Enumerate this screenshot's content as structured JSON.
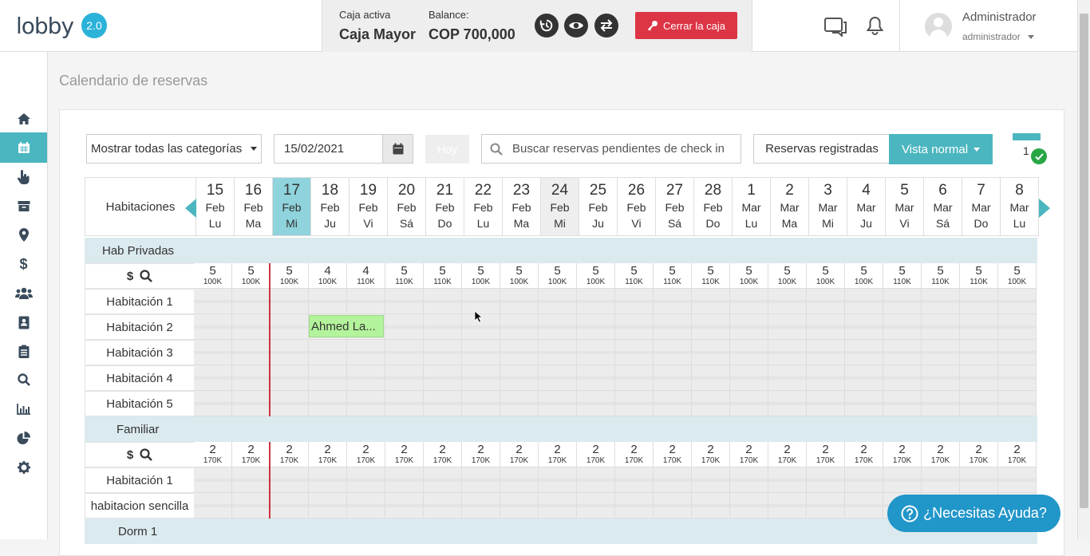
{
  "app": {
    "logo": "lobby",
    "version": "2.0"
  },
  "cash": {
    "active_label": "Caja activa",
    "active_value": "Caja Mayor",
    "balance_label": "Balance:",
    "balance_value": "COP 700,000",
    "close_label": "Cerrar la caja"
  },
  "user": {
    "name": "Administrador",
    "role": "administrador"
  },
  "sidebar": [
    {
      "icon": "home-icon"
    },
    {
      "icon": "calendar-icon",
      "active": true
    },
    {
      "icon": "hand-pointer-icon"
    },
    {
      "icon": "archive-icon"
    },
    {
      "icon": "map-marker-icon"
    },
    {
      "icon": "dollar-icon"
    },
    {
      "icon": "users-icon"
    },
    {
      "icon": "address-book-icon"
    },
    {
      "icon": "clipboard-icon"
    },
    {
      "icon": "search-icon"
    },
    {
      "icon": "bar-chart-icon"
    },
    {
      "icon": "pie-chart-icon"
    },
    {
      "icon": "gear-icon"
    }
  ],
  "page": {
    "title": "Calendario de reservas"
  },
  "toolbar": {
    "category_select": "Mostrar todas las categorías",
    "date_value": "15/02/2021",
    "today_label": "Hoy",
    "search_placeholder": "Buscar reservas pendientes de check in",
    "registered_label": "Reservas registradas",
    "view_label": "Vista normal",
    "notification_count": "1"
  },
  "calendar": {
    "rooms_header": "Habitaciones",
    "days": [
      {
        "d": "15",
        "m": "Feb",
        "w": "Lu"
      },
      {
        "d": "16",
        "m": "Feb",
        "w": "Ma"
      },
      {
        "d": "17",
        "m": "Feb",
        "w": "Mi",
        "today": true
      },
      {
        "d": "18",
        "m": "Feb",
        "w": "Ju"
      },
      {
        "d": "19",
        "m": "Feb",
        "w": "Vi"
      },
      {
        "d": "20",
        "m": "Feb",
        "w": "Sá"
      },
      {
        "d": "21",
        "m": "Feb",
        "w": "Do"
      },
      {
        "d": "22",
        "m": "Feb",
        "w": "Lu"
      },
      {
        "d": "23",
        "m": "Feb",
        "w": "Ma"
      },
      {
        "d": "24",
        "m": "Feb",
        "w": "Mi",
        "highlight": true
      },
      {
        "d": "25",
        "m": "Feb",
        "w": "Ju"
      },
      {
        "d": "26",
        "m": "Feb",
        "w": "Vi"
      },
      {
        "d": "27",
        "m": "Feb",
        "w": "Sá"
      },
      {
        "d": "28",
        "m": "Feb",
        "w": "Do"
      },
      {
        "d": "1",
        "m": "Mar",
        "w": "Lu"
      },
      {
        "d": "2",
        "m": "Mar",
        "w": "Ma"
      },
      {
        "d": "3",
        "m": "Mar",
        "w": "Mi"
      },
      {
        "d": "4",
        "m": "Mar",
        "w": "Ju"
      },
      {
        "d": "5",
        "m": "Mar",
        "w": "Vi"
      },
      {
        "d": "6",
        "m": "Mar",
        "w": "Sá"
      },
      {
        "d": "7",
        "m": "Mar",
        "w": "Do"
      },
      {
        "d": "8",
        "m": "Mar",
        "w": "Lu"
      }
    ],
    "categories": [
      {
        "name": "Hab Privadas",
        "availability": [
          [
            "5",
            "100K"
          ],
          [
            "5",
            "100K"
          ],
          [
            "5",
            "100K"
          ],
          [
            "4",
            "100K"
          ],
          [
            "4",
            "110K"
          ],
          [
            "5",
            "110K"
          ],
          [
            "5",
            "110K"
          ],
          [
            "5",
            "100K"
          ],
          [
            "5",
            "100K"
          ],
          [
            "5",
            "100K"
          ],
          [
            "5",
            "100K"
          ],
          [
            "5",
            "110K"
          ],
          [
            "5",
            "110K"
          ],
          [
            "5",
            "110K"
          ],
          [
            "5",
            "100K"
          ],
          [
            "5",
            "100K"
          ],
          [
            "5",
            "100K"
          ],
          [
            "5",
            "100K"
          ],
          [
            "5",
            "110K"
          ],
          [
            "5",
            "110K"
          ],
          [
            "5",
            "110K"
          ],
          [
            "5",
            "100K"
          ]
        ],
        "rooms": [
          "Habitación 1",
          "Habitación 2",
          "Habitación 3",
          "Habitación 4",
          "Habitación 5"
        ]
      },
      {
        "name": "Familiar",
        "availability": [
          [
            "2",
            "170K"
          ],
          [
            "2",
            "170K"
          ],
          [
            "2",
            "170K"
          ],
          [
            "2",
            "170K"
          ],
          [
            "2",
            "170K"
          ],
          [
            "2",
            "170K"
          ],
          [
            "2",
            "170K"
          ],
          [
            "2",
            "170K"
          ],
          [
            "2",
            "170K"
          ],
          [
            "2",
            "170K"
          ],
          [
            "2",
            "170K"
          ],
          [
            "2",
            "170K"
          ],
          [
            "2",
            "170K"
          ],
          [
            "2",
            "170K"
          ],
          [
            "2",
            "170K"
          ],
          [
            "2",
            "170K"
          ],
          [
            "2",
            "170K"
          ],
          [
            "2",
            "170K"
          ],
          [
            "2",
            "170K"
          ],
          [
            "2",
            "170K"
          ],
          [
            "2",
            "170K"
          ],
          [
            "2",
            "170K"
          ]
        ],
        "rooms": [
          "Habitación 1",
          "habitacion sencilla"
        ]
      },
      {
        "name": "Dorm 1",
        "availability": [],
        "rooms": []
      }
    ],
    "booking": {
      "guest": "Ahmed La..."
    }
  },
  "help": {
    "label": "¿Necesitas Ayuda?"
  },
  "colors": {
    "accent": "#4bb6bf",
    "danger": "#dc3545",
    "booking": "#b3f39b",
    "help": "#2196c9"
  }
}
